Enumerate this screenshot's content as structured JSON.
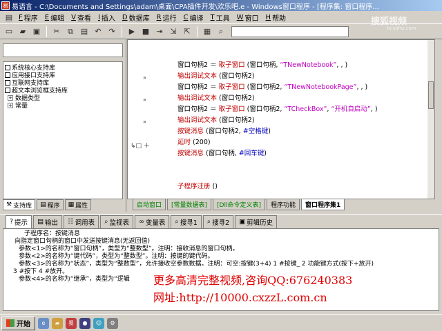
{
  "window": {
    "title": "易语言 - C:\\Documents and Settings\\adam\\桌面\\CPA插件开发\\欢乐吧.e - Windows窗口程序 - [程序集: 窗口程序..."
  },
  "menu": [
    {
      "key": "F",
      "label": "程序"
    },
    {
      "key": "E",
      "label": "编辑"
    },
    {
      "key": "V",
      "label": "查看"
    },
    {
      "key": "I",
      "label": "插入"
    },
    {
      "key": "D",
      "label": "数据库"
    },
    {
      "key": "R",
      "label": "运行"
    },
    {
      "key": "C",
      "label": "编译"
    },
    {
      "key": "T",
      "label": "工具"
    },
    {
      "key": "W",
      "label": "窗口"
    },
    {
      "key": "H",
      "label": "帮助"
    }
  ],
  "tree": [
    {
      "label": "系统核心支持库"
    },
    {
      "label": "应用接口支持库"
    },
    {
      "label": "互联网支持库"
    },
    {
      "label": "超文本浏览框支持库"
    },
    {
      "label": "数据类型"
    },
    {
      "label": "常量"
    }
  ],
  "left_tabs": [
    "支持库",
    "程序",
    "属性"
  ],
  "code_lines": [
    {
      "parts": [
        {
          "t": "窗口句柄2 ＝ ",
          "c": ""
        },
        {
          "t": "取子窗口",
          "c": "c-red"
        },
        {
          "t": " (窗口句柄, ",
          "c": ""
        },
        {
          "t": "“TNewNotebook”",
          "c": "c-mag"
        },
        {
          "t": ", , )",
          "c": ""
        }
      ]
    },
    {
      "parts": [
        {
          "t": "输出调试文本",
          "c": "c-red"
        },
        {
          "t": " (窗口句柄2)",
          "c": ""
        }
      ]
    },
    {
      "parts": [
        {
          "t": "窗口句柄2 ＝ ",
          "c": ""
        },
        {
          "t": "取子窗口",
          "c": "c-red"
        },
        {
          "t": " (窗口句柄2, ",
          "c": ""
        },
        {
          "t": "“TNewNotebookPage”",
          "c": "c-mag"
        },
        {
          "t": ", , )",
          "c": ""
        }
      ]
    },
    {
      "parts": [
        {
          "t": "输出调试文本",
          "c": "c-red"
        },
        {
          "t": " (窗口句柄2)",
          "c": ""
        }
      ]
    },
    {
      "parts": [
        {
          "t": "窗口句柄2 ＝ ",
          "c": ""
        },
        {
          "t": "取子窗口",
          "c": "c-red"
        },
        {
          "t": " (窗口句柄2, ",
          "c": ""
        },
        {
          "t": "“TCheckBox”",
          "c": "c-mag"
        },
        {
          "t": ", ",
          "c": ""
        },
        {
          "t": "“开机自启动”",
          "c": "c-mag"
        },
        {
          "t": ", )",
          "c": ""
        }
      ]
    },
    {
      "parts": [
        {
          "t": "输出调试文本",
          "c": "c-red"
        },
        {
          "t": " (窗口句柄2)",
          "c": ""
        }
      ]
    },
    {
      "parts": [
        {
          "t": "按键消息",
          "c": "c-red"
        },
        {
          "t": " (窗口句柄2, ",
          "c": ""
        },
        {
          "t": "#空格键",
          "c": "c-blue"
        },
        {
          "t": ")",
          "c": ""
        }
      ]
    },
    {
      "parts": [
        {
          "t": "延时",
          "c": "c-red"
        },
        {
          "t": " (200)",
          "c": ""
        }
      ]
    },
    {
      "parts": [
        {
          "t": "按键消息",
          "c": "c-red"
        },
        {
          "t": " (窗口句柄, ",
          "c": ""
        },
        {
          "t": "#回车键",
          "c": "c-blue"
        },
        {
          "t": ")",
          "c": ""
        }
      ]
    },
    {
      "parts": [
        {
          "t": "",
          "c": ""
        }
      ]
    },
    {
      "parts": [
        {
          "t": "",
          "c": ""
        }
      ]
    },
    {
      "parts": [
        {
          "t": "子程序注册",
          "c": "c-red"
        },
        {
          "t": " ()",
          "c": ""
        }
      ]
    }
  ],
  "editor_tabs": [
    {
      "label": "启动窗口",
      "style": ""
    },
    {
      "label": "[常量数据表]",
      "style": ""
    },
    {
      "label": "[Dll命令定义表]",
      "style": ""
    },
    {
      "label": "程序功能",
      "style": "plain"
    },
    {
      "label": "窗口程序集1",
      "style": "active"
    }
  ],
  "bottom_tabs": [
    "提示",
    "输出",
    "调用表",
    "监视表",
    "变量表",
    "搜寻1",
    "搜寻2",
    "剪辑历史"
  ],
  "output_lines": [
    "子程序名：按键消息",
    "向指定窗口句柄的窗口中发送按键消息(无返回值)",
    "参数<1>的名称为“窗口句柄”，类型为“整数型”。注明：接收消息的窗口句柄。",
    "参数<2>的名称为“键代码”，类型为“整数型”。注明：按键的键代码。",
    "参数<3>的名称为“状态”，类型为“整数型”，允许接收空参数数据。注明：可空:按键(3+4)  1 #按键_  2 功能键方式(按下+放开)",
    "3 #按下   4 #放开。",
    "参数<4>的名称为“继承”，类型为“逻辑"
  ],
  "overlay": {
    "line1": "更多高清完整视频,咨询QQ:676240383",
    "line2": "网址:http://10000.cxzzL.com.cn",
    "watermark": "搜狐视频",
    "watermark_sub": "tv.sohu.com"
  },
  "taskbar": {
    "start_label": "开始"
  }
}
